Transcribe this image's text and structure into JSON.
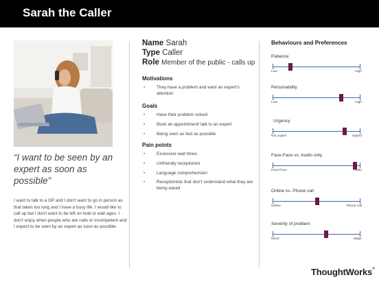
{
  "header": {
    "title": "Sarah the Caller"
  },
  "persona": {
    "photo_alt": "photo of woman on phone with laptop on sofa",
    "quote": "“I want to be seen by an expert as soon as possible”",
    "bio": "I want to talk to a GP and I don’t want to go in person as that takes too long and I have a busy life. I would like to call up but I don’t want to be left on hold or wait ages. I don’t enjoy when people who are rude or incompetent and I expect to be seen by an expert as soon as possible."
  },
  "details": {
    "name_label": "Name",
    "name_value": "Sarah",
    "type_label": "Type",
    "type_value": "Caller",
    "role_label": "Role",
    "role_value": "Member of the public - calls up"
  },
  "motivations": {
    "heading": "Motivations",
    "items": [
      "They have a problem and want an expert’s attention"
    ]
  },
  "goals": {
    "heading": "Goals",
    "items": [
      "Have their problem solved",
      "Book an appointment/ talk to an expert",
      "Being seen as fast as possible"
    ]
  },
  "pain_points": {
    "heading": "Pain points",
    "items": [
      "Excessive wait times",
      "Unfriendly receptionist",
      "Language comprehension",
      "Receptionists that don’t understand what they are being asked"
    ]
  },
  "behaviours": {
    "heading": "Behaviours and Preferences",
    "accent_color": "#6b1a46",
    "track_color": "#3a66b0",
    "sliders": [
      {
        "label": "Patience",
        "low": "Low",
        "high": "High",
        "level": 0.2
      },
      {
        "label": "Personability",
        "low": "Low",
        "high": "High",
        "level": 0.78
      },
      {
        "label": "Urgency",
        "low": "Not urgent",
        "high": "Urgent",
        "level": 0.82
      },
      {
        "label": "Face-Face vs. Audio only",
        "low": "Face-Face",
        "high": "Audio",
        "level": 0.94
      },
      {
        "label": "Online vs. Phone call",
        "low": "Online",
        "high": "Phone call",
        "level": 0.51
      },
      {
        "label": "Severity of problem",
        "low": "Minor",
        "high": "Major",
        "level": 0.61
      }
    ]
  },
  "footer": {
    "logo_text": "ThoughtWorks",
    "logo_mark": "®"
  }
}
